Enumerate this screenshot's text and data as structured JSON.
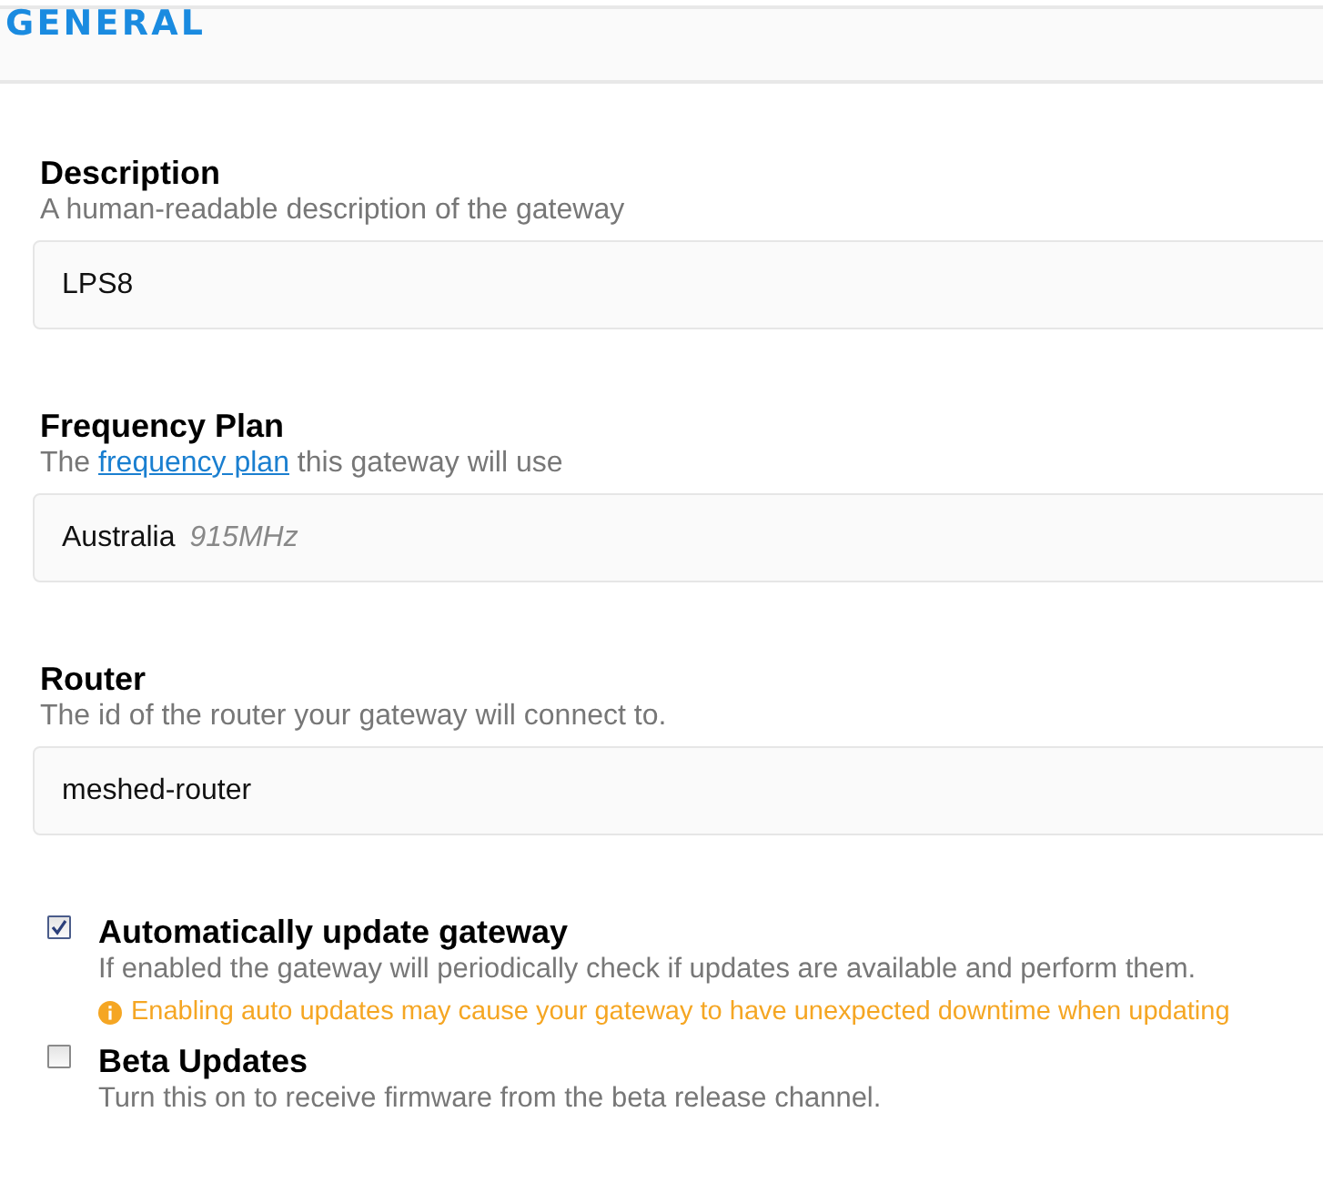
{
  "header": {
    "title": "GENERAL"
  },
  "fields": [
    {
      "label": "Description",
      "hint": [
        {
          "kind": "text",
          "text": "A human-readable description of the gateway"
        }
      ],
      "value": "LPS8"
    },
    {
      "label": "Frequency Plan",
      "hint": [
        {
          "kind": "text",
          "text": "The "
        },
        {
          "kind": "link",
          "text": "frequency plan"
        },
        {
          "kind": "text",
          "text": " this gateway will use"
        }
      ],
      "value": "Australia",
      "value_note": "915MHz"
    },
    {
      "label": "Router",
      "hint": [
        {
          "kind": "text",
          "text": "The id of the router your gateway will connect to."
        }
      ],
      "value": "meshed-router"
    }
  ],
  "options": [
    {
      "label": "Automatically update gateway",
      "checked": true,
      "description": "If enabled the gateway will periodically check if updates are available and perform them.",
      "warning": "Enabling auto updates may cause your gateway to have unexpected downtime when updating"
    },
    {
      "label": "Beta Updates",
      "checked": false,
      "description": "Turn this on to receive firmware from the beta release channel."
    }
  ]
}
